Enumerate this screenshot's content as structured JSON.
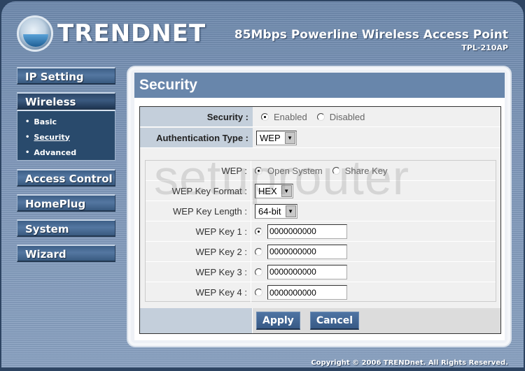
{
  "header": {
    "brand": "TRENDNET",
    "product_title": "85Mbps Powerline Wireless Access Point",
    "model": "TPL-210AP"
  },
  "sidebar": {
    "items": [
      {
        "label": "IP Setting",
        "active": false
      },
      {
        "label": "Wireless",
        "active": true
      },
      {
        "label": "Access Control",
        "active": false
      },
      {
        "label": "HomePlug",
        "active": false
      },
      {
        "label": "System",
        "active": false
      },
      {
        "label": "Wizard",
        "active": false
      }
    ],
    "wireless_submenu": [
      {
        "label": "Basic",
        "current": false
      },
      {
        "label": "Security",
        "current": true
      },
      {
        "label": "Advanced",
        "current": false
      }
    ]
  },
  "main": {
    "title": "Security",
    "security": {
      "label": "Security :",
      "options": [
        "Enabled",
        "Disabled"
      ],
      "selected": "Enabled"
    },
    "auth_type": {
      "label": "Authentication Type :",
      "value": "WEP"
    },
    "wep": {
      "label": "WEP :",
      "options": [
        "Open System",
        "Share Key"
      ],
      "selected": "Open System"
    },
    "key_format": {
      "label": "WEP Key Format :",
      "value": "HEX"
    },
    "key_length": {
      "label": "WEP Key Length :",
      "value": "64-bit"
    },
    "keys": [
      {
        "label": "WEP Key 1 :",
        "value": "0000000000",
        "selected": true
      },
      {
        "label": "WEP Key 2 :",
        "value": "0000000000",
        "selected": false
      },
      {
        "label": "WEP Key 3 :",
        "value": "0000000000",
        "selected": false
      },
      {
        "label": "WEP Key 4 :",
        "value": "0000000000",
        "selected": false
      }
    ],
    "buttons": {
      "apply": "Apply",
      "cancel": "Cancel"
    }
  },
  "watermark": "setuprouter",
  "footer": {
    "copyright": "Copyright © 2006 TRENDnet. All Rights Reserved."
  }
}
